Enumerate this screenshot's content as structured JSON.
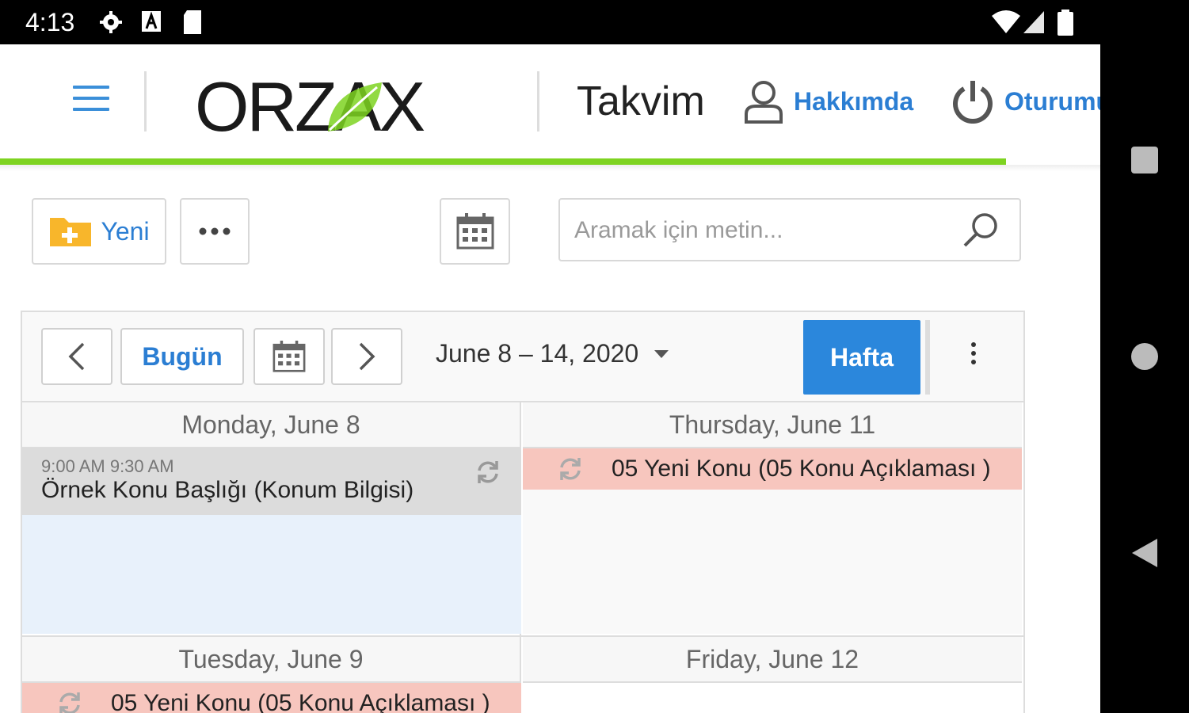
{
  "status_bar": {
    "time": "4:13"
  },
  "header": {
    "logo": "ORZAX",
    "page_title": "Takvim",
    "about_label": "Hakkımda",
    "logout_label": "Oturumu",
    "accent_color": "#7ed321",
    "link_color": "#2b7ed3"
  },
  "toolbar": {
    "new_label": "Yeni",
    "search_placeholder": "Aramak için metin..."
  },
  "scheduler": {
    "today_label": "Bugün",
    "date_range": "June 8 – 14, 2020",
    "view_label": "Hafta",
    "days": [
      {
        "title": "Monday, June 8",
        "appointment": {
          "time": "9:00 AM 9:30 AM",
          "subject": "Örnek Konu Başlığı (Konum Bilgisi)"
        }
      },
      {
        "title": "Thursday, June 11",
        "appointment": {
          "subject": "05 Yeni Konu (05 Konu Açıklaması )"
        }
      },
      {
        "title": "Tuesday, June 9",
        "appointment": {
          "subject": "05 Yeni Konu (05 Konu Açıklaması )"
        }
      },
      {
        "title": "Friday, June 12"
      }
    ]
  }
}
